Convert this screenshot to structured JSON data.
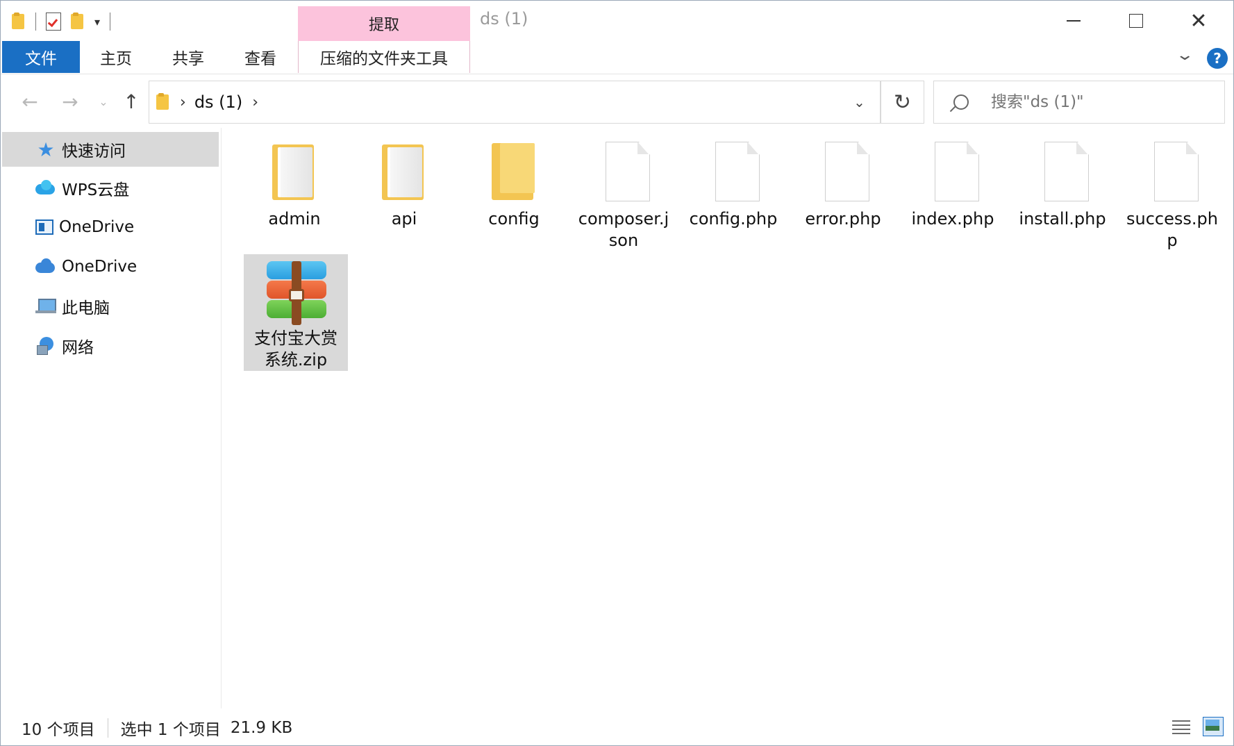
{
  "window": {
    "title": "ds (1)"
  },
  "ribbon": {
    "context_tab_group": "提取",
    "tabs": [
      {
        "label": "文件"
      },
      {
        "label": "主页"
      },
      {
        "label": "共享"
      },
      {
        "label": "查看"
      },
      {
        "label": "压缩的文件夹工具"
      }
    ],
    "help_label": "?"
  },
  "address_bar": {
    "path": [
      "ds (1)"
    ]
  },
  "search": {
    "placeholder": "搜索\"ds (1)\""
  },
  "sidebar": {
    "items": [
      {
        "label": "快速访问",
        "icon": "star-icon",
        "selected": true
      },
      {
        "label": "WPS云盘",
        "icon": "wps-cloud-icon"
      },
      {
        "label": "OneDrive",
        "icon": "onedrive-business-icon"
      },
      {
        "label": "OneDrive",
        "icon": "onedrive-cloud-icon"
      },
      {
        "label": "此电脑",
        "icon": "this-pc-icon"
      },
      {
        "label": "网络",
        "icon": "network-icon"
      }
    ]
  },
  "files": [
    {
      "name": "admin",
      "type": "folder-full"
    },
    {
      "name": "api",
      "type": "folder-full"
    },
    {
      "name": "config",
      "type": "folder-empty"
    },
    {
      "name": "composer.json",
      "type": "document"
    },
    {
      "name": "config.php",
      "type": "document"
    },
    {
      "name": "error.php",
      "type": "document"
    },
    {
      "name": "index.php",
      "type": "document"
    },
    {
      "name": "install.php",
      "type": "document"
    },
    {
      "name": "success.php",
      "type": "document"
    },
    {
      "name": "支付宝大赏系统.zip",
      "type": "zip-archive",
      "selected": true
    }
  ],
  "status": {
    "item_count": "10 个项目",
    "selected_count": "选中 1 个项目",
    "selected_size": "21.9 KB"
  },
  "colors": {
    "accent": "#1a6fc4",
    "context_tab": "#fcc3dc",
    "selection": "#d9d9d9"
  }
}
